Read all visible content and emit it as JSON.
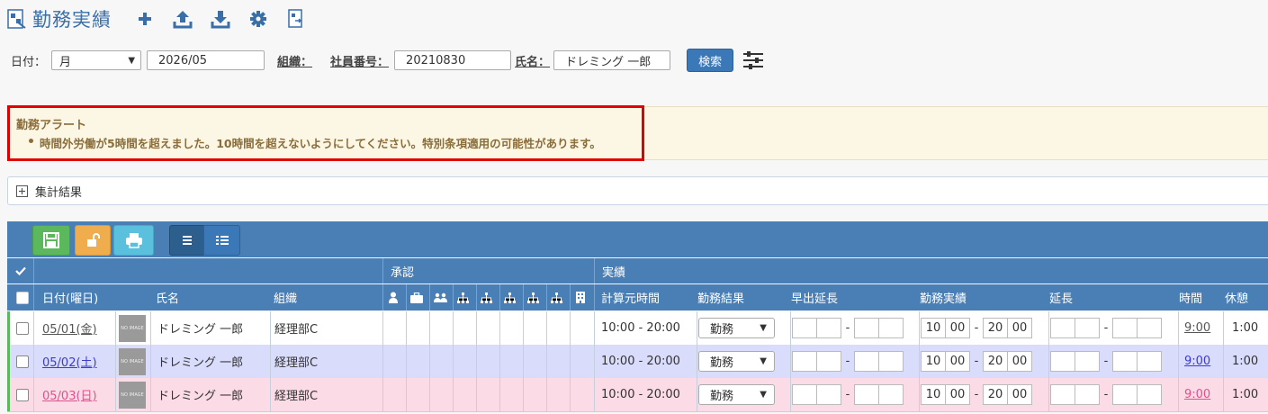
{
  "header": {
    "title": "勤務実績",
    "icons": [
      "timesheet-icon",
      "plus-icon",
      "upload-icon",
      "download-icon",
      "gear-icon",
      "export-icon"
    ]
  },
  "filters": {
    "date_label": "日付：",
    "period_value": "月",
    "month_value": "2026/05",
    "org_label": "組織：",
    "emp_no_label": "社員番号：",
    "emp_no_value": "20210830",
    "name_label": "氏名：",
    "name_value": "ドレミング 一郎",
    "search_label": "検索"
  },
  "alert": {
    "title": "勤務アラート",
    "message": "時間外労働が5時間を超えました。10時間を超えないようにしてください。特別条項適用の可能性があります。",
    "border_color": "#e00000"
  },
  "summary": {
    "label": "集計結果"
  },
  "grid": {
    "group_headers": {
      "approval": "承認",
      "actual": "実績"
    },
    "columns": {
      "date": "日付(曜日)",
      "name": "氏名",
      "org": "組織",
      "calc_time": "計算元時間",
      "work_result": "勤務結果",
      "early_ext": "早出延長",
      "actual_work": "勤務実績",
      "extension": "延長",
      "time": "時間",
      "break": "休憩"
    },
    "rows": [
      {
        "date": "05/01(金)",
        "photo": "NO IMAGE",
        "name": "ドレミング 一郎",
        "org": "経理部C",
        "calc_time": "10:00 - 20:00",
        "work_result": "勤務",
        "start_h": "10",
        "start_m": "00",
        "end_h": "20",
        "end_m": "00",
        "time": "9:00",
        "break": "1:00",
        "bg": "#ffffff",
        "date_color": "#555555",
        "bar": "#5cb85c"
      },
      {
        "date": "05/02(土)",
        "photo": "NO IMAGE",
        "name": "ドレミング 一郎",
        "org": "経理部C",
        "calc_time": "10:00 - 20:00",
        "work_result": "勤務",
        "start_h": "10",
        "start_m": "00",
        "end_h": "20",
        "end_m": "00",
        "time": "9:00",
        "break": "1:00",
        "bg": "#d9dcfb",
        "date_color": "#3b3bd0",
        "bar": "#5cb85c"
      },
      {
        "date": "05/03(日)",
        "photo": "NO IMAGE",
        "name": "ドレミング 一郎",
        "org": "経理部C",
        "calc_time": "10:00 - 20:00",
        "work_result": "勤務",
        "start_h": "10",
        "start_m": "00",
        "end_h": "20",
        "end_m": "00",
        "time": "9:00",
        "break": "1:00",
        "bg": "#fbdbe6",
        "date_color": "#e0508a",
        "bar": "#5cb85c"
      }
    ]
  },
  "colors": {
    "accent": "#3a78b8",
    "grid_header": "#4a7fb5"
  }
}
